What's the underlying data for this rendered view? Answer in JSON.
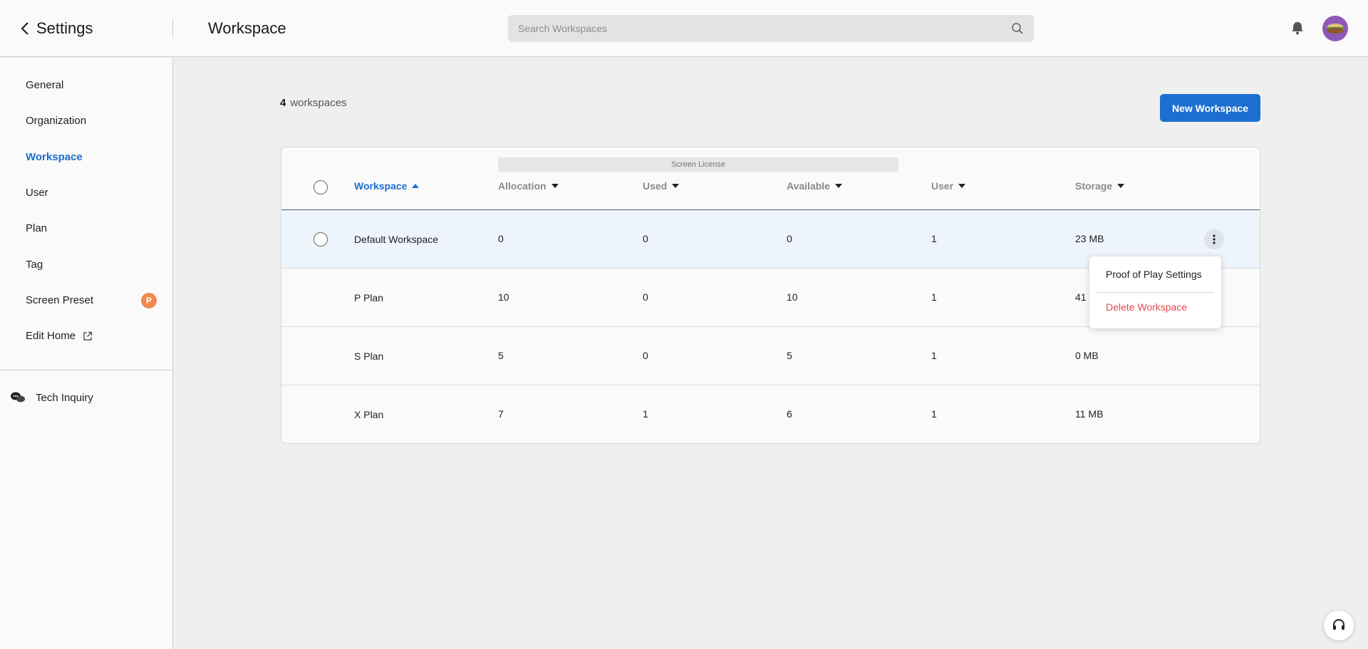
{
  "header": {
    "settings_title": "Settings",
    "page_title": "Workspace",
    "search_placeholder": "Search Workspaces"
  },
  "sidebar": {
    "items": [
      {
        "label": "General"
      },
      {
        "label": "Organization"
      },
      {
        "label": "Workspace",
        "active": true
      },
      {
        "label": "User"
      },
      {
        "label": "Plan"
      },
      {
        "label": "Tag"
      },
      {
        "label": "Screen Preset",
        "badge": "P"
      },
      {
        "label": "Edit Home",
        "icon": "external-link-icon"
      }
    ],
    "tech_inquiry": "Tech Inquiry"
  },
  "main": {
    "count": "4",
    "count_label": "workspaces",
    "new_button": "New Workspace",
    "table": {
      "group_header": "Screen License",
      "columns": [
        "Workspace",
        "Allocation",
        "Used",
        "Available",
        "User",
        "Storage"
      ],
      "rows": [
        {
          "name": "Default Workspace",
          "allocation": "0",
          "used": "0",
          "available": "0",
          "user": "1",
          "storage": "23 MB"
        },
        {
          "name": "P Plan",
          "allocation": "10",
          "used": "0",
          "available": "10",
          "user": "1",
          "storage": "41"
        },
        {
          "name": "S Plan",
          "allocation": "5",
          "used": "0",
          "available": "5",
          "user": "1",
          "storage": "0 MB"
        },
        {
          "name": "X Plan",
          "allocation": "7",
          "used": "1",
          "available": "6",
          "user": "1",
          "storage": "11 MB"
        }
      ]
    },
    "row_menu": {
      "items": [
        "Proof of Play Settings",
        "Delete Workspace"
      ]
    }
  },
  "colors": {
    "accent": "#1c6fd1",
    "danger": "#e5484d",
    "badge": "#f1884c"
  }
}
